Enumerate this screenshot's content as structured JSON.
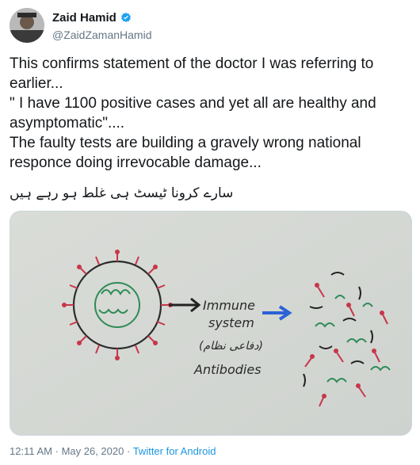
{
  "author": {
    "name": "Zaid Hamid",
    "handle": "@ZaidZamanHamid",
    "verified_icon": "verified-badge-icon"
  },
  "tweet": {
    "text": "This confirms statement of the doctor I was referring to earlier...\n\" I have 1100 positive cases and yet all are healthy and asymptomatic\"....\nThe faulty tests are building a gravely wrong national responce doing irrevocable damage...",
    "urdu_text": "سارے کرونا ٹیسٹ ہی غلط ہو رہے ہیں ہیں۔۔۔"
  },
  "media": {
    "whiteboard_words": [
      "Immune",
      "system",
      "(دفاعی نظام)",
      "Antibodies"
    ]
  },
  "meta": {
    "time": "12:11 AM",
    "separator": "·",
    "date": "May 26, 2020",
    "source": "Twitter for Android"
  },
  "colors": {
    "name": "#14171a",
    "secondary": "#657786",
    "link": "#1b95e0",
    "verified": "#1da1f2"
  }
}
